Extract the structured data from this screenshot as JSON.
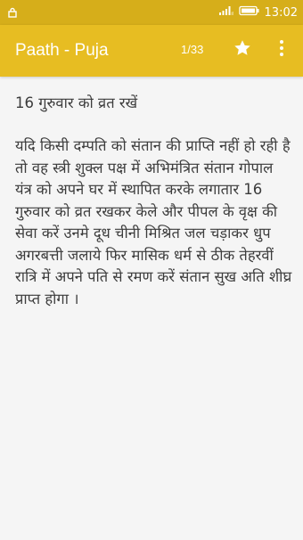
{
  "status_bar": {
    "time": "13:02",
    "icons": [
      "lock-icon",
      "signal-icon",
      "battery-icon"
    ],
    "color": "#d6ae1a"
  },
  "app_bar": {
    "title": "Paath - Puja",
    "page_counter": "1/33",
    "actions": [
      "star-icon",
      "more-vert-icon"
    ],
    "color": "#e7bd22"
  },
  "content": {
    "heading": "16 गुरुवार को व्रत रखें",
    "body": "यदि किसी दम्पति को संतान की प्राप्ति नहीं हो रही है तो वह स्त्री शुक्ल पक्ष में अभिमंत्रित संतान गोपाल यंत्र को अपने घर में स्थापित करके लगातार 16 गुरुवार को व्रत रखकर केले और पीपल के वृक्ष की सेवा करें उनमे दूध चीनी मिश्रित जल चड़ाकर धुप अगरबत्ती जलाये फिर मासिक धर्म से ठीक तेहरवीं रात्रि में अपने पति से रमण करें संतान सुख अति शीघ्र प्राप्त होगा ।",
    "text_color": "#3c3c3c"
  }
}
